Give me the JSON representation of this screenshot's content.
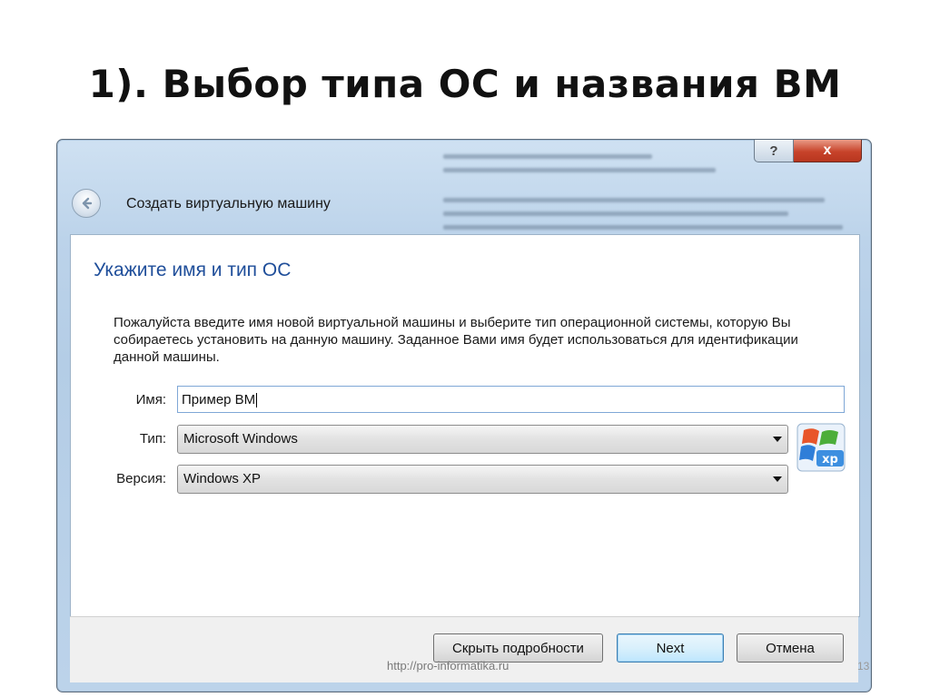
{
  "slide": {
    "title": "1). Выбор типа ОС и названия ВМ",
    "footer_url": "http://pro-informatika.ru",
    "page_number": "13"
  },
  "window": {
    "help_glyph": "?",
    "close_glyph": "x"
  },
  "wizard": {
    "caption": "Создать виртуальную машину",
    "heading": "Укажите имя и тип ОС",
    "description": "Пожалуйста введите имя новой виртуальной машины и выберите тип операционной системы, которую Вы собираетесь установить на данную машину. Заданное Вами имя будет использоваться для идентификации данной машины.",
    "name_label": "Имя:",
    "name_value": "Пример ВМ",
    "type_label": "Тип:",
    "type_value": "Microsoft Windows",
    "version_label": "Версия:",
    "version_value": "Windows XP",
    "os_icon_text": "xp",
    "buttons": {
      "hide_details": "Скрыть подробности",
      "next": "Next",
      "cancel": "Отмена"
    }
  }
}
